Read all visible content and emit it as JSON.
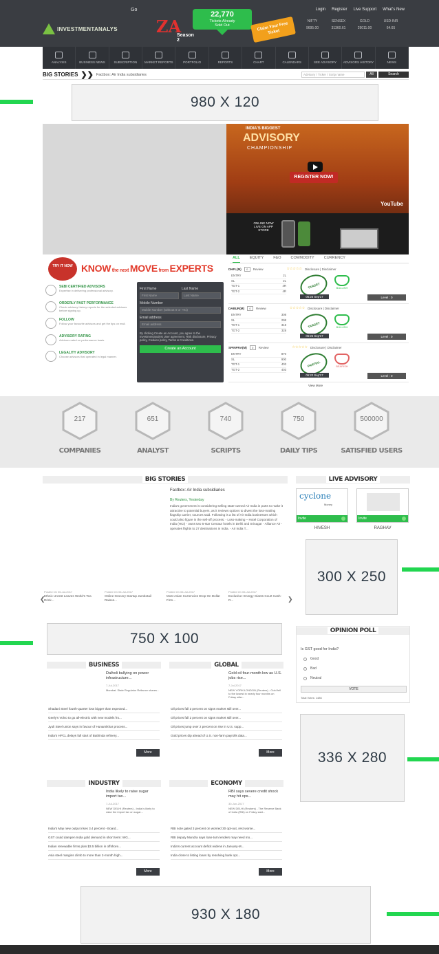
{
  "header": {
    "go_label": "Go",
    "links": [
      "Login",
      "Register",
      "Live Support",
      "What's New"
    ],
    "logo_text": "INVESTMENTANALYS",
    "ticket": {
      "count": "22,770",
      "sub1": "Tickets Already",
      "sub2": "Sold Out"
    },
    "champ_logo": {
      "mark": "ZA",
      "edition": "Season 2"
    },
    "ticket_badge": "Claim Your Free Ticket",
    "market": {
      "names": [
        "NIFTY",
        "SENSEX",
        "GOLD",
        "USD-INR"
      ],
      "values": [
        "9695.00",
        "31360.61",
        "29011.00",
        "64.65"
      ]
    }
  },
  "nav": {
    "items": [
      "Analysis",
      "Business News",
      "Subscription",
      "Market Reports",
      "Portfolio",
      "Reports",
      "Chart",
      "Calendars",
      "SEE Advisory",
      "Advisors History",
      "News"
    ]
  },
  "ticker": {
    "label": "BIG STORIES",
    "arrows": "❯❯",
    "headline": "Factbox: Air India subsidiaries",
    "search_placeholder": "Advisory / Ticker / Scrip name",
    "select_value": "All",
    "search_button": "Search"
  },
  "ads": {
    "top": "980 X 120",
    "mid": "300 X 250",
    "wide": "750 X 100",
    "side": "336 X 280",
    "bottom": "930 X 180"
  },
  "promo": {
    "title1": "INDIA'S BIGGEST",
    "title2": "ADVISORY",
    "title3": "CHAMPIONSHIP",
    "register": "REGISTER NOW!",
    "youtube": "YouTube",
    "live": "ONLINE NOW LIVE ON APP STORE"
  },
  "know": {
    "badge": "TRY IT NOW",
    "w1": "KNOW",
    "s1": " the next ",
    "w2": "MOVE",
    "s2": " from ",
    "w3": "EXPERTS",
    "features": [
      {
        "title": "SEBI CERTIFIED ADVISORS",
        "desc": "Expertise in delivering professional advisory."
      },
      {
        "title": "ORDERLY PAST PERFORMANCE",
        "desc": "Check advisory history reports for the selected advisors before signing up."
      },
      {
        "title": "FOLLOW",
        "desc": "Follow your favourite advisors and get the tips on mail."
      },
      {
        "title": "ADVISORY RATING",
        "desc": "Advisors rated on performance basis."
      },
      {
        "title": "LEGALITY ADVISORY",
        "desc": "Choose advisors that operated in legal manner."
      }
    ]
  },
  "form": {
    "first_name": "First Name",
    "last_name": "Last Name",
    "mobile": "Mobile Number",
    "mobile_placeholder": "Mobile Number (without 0 or +91)",
    "email": "Email address",
    "email_placeholder": "Email address",
    "terms": "By clicking Create an Account, you agree to the Investmentanalyst User agreement, Risk disclosure, Privacy policy, Cookies policy, Terms & Conditions.",
    "button": "Create an Account"
  },
  "tabs": [
    "ALL",
    "EQUITY",
    "F&O",
    "COMMODITY",
    "CURRENCY"
  ],
  "tips": [
    {
      "name": "DHFL(M)",
      "date": "06:25 Sep'17",
      "status": "TARGET",
      "type": "BULLISH",
      "level": "Level : 0",
      "rows": [
        [
          "ENTRY",
          "2L"
        ],
        [
          "SL",
          "2L"
        ],
        [
          "TGT-1",
          "4R"
        ],
        [
          "TGT-2",
          "4R"
        ]
      ],
      "review": "Review",
      "disc": "Disclosure | Disclaimer"
    },
    {
      "name": "DABUR(M)",
      "date": "06:25 Sep'17",
      "status": "TARGET",
      "type": "BULLISH",
      "level": "Level : 0",
      "rows": [
        [
          "ENTRY",
          "308"
        ],
        [
          "SL",
          "298"
        ],
        [
          "TGT-1",
          "318"
        ],
        [
          "TGT-2",
          "328"
        ]
      ],
      "review": "Review",
      "disc": "Disclosure | Disclaimer"
    },
    {
      "name": "SPINPRA(M)",
      "date": "06:22 Sep'17",
      "status": "PARTIAL",
      "type": "BEARISH",
      "level": "Level : 0",
      "rows": [
        [
          "ENTRY",
          "870"
        ],
        [
          "SL",
          "900"
        ],
        [
          "TGT-1",
          "403"
        ],
        [
          "TGT-2",
          "403"
        ]
      ],
      "review": "Review",
      "disc": "Disclosure | Disclaimer"
    }
  ],
  "view_more": "View More",
  "stats": [
    {
      "value": "217",
      "label": "COMPANIES"
    },
    {
      "value": "651",
      "label": "ANALYST"
    },
    {
      "value": "740",
      "label": "SCRIPTS"
    },
    {
      "value": "750",
      "label": "DAILY TIPS"
    },
    {
      "value": "500000",
      "label": "SATISFIED USERS"
    }
  ],
  "big_stories": {
    "heading": "BIG STORIES",
    "title": "Factbox: Air India subsidiaries",
    "byline": "By Reuters, Yesterday",
    "body": "India's government is considering selling state-owned Air India in parts to make it attractive to potential buyers, as it reviews options to divest the loss-making flagship carrier, sources said. Following is a list of Air India businesses which could also figure in the sell-off process: - Loss-making – Hotel Corporation of India (HCI) - owns two 5-star Centaur hotels in Delhi and Srinagar - Alliance Air - operates flights to 27 destinations in India. - Air India T...",
    "carousel": [
      {
        "date": "Posted On 06-Jul-2017",
        "title": "Ethnic Unrest Leaves World's Tea Drink..."
      },
      {
        "date": "Posted On 06-Jul-2017",
        "title": "Online Grocery Startup Jumbotail Raises..."
      },
      {
        "date": "Posted On 06-Jul-2017",
        "title": "Most Asian Currencies Drop On Dollar Firm..."
      },
      {
        "date": "Posted On 06-Jul-2017",
        "title": "Exclusive: Energy Giants Court Cash-R..."
      }
    ]
  },
  "live_advisory": {
    "heading": "LIVE ADVISORY",
    "advisors": [
      {
        "name": "Invite",
        "label": "HIVESH",
        "logo": "cyclone",
        "logo_sub": "Money"
      },
      {
        "name": "Invite",
        "label": "RAGHAV"
      }
    ]
  },
  "poll": {
    "heading": "OPINION POLL",
    "question": "Is GST good for India?",
    "options": [
      "Good",
      "Bad",
      "Neutral"
    ],
    "vote": "VOTE",
    "total": "Total Votes: 1486"
  },
  "news": {
    "business": {
      "heading": "BUSINESS",
      "feat_title": "Dalholi bullying on power infrastructure...",
      "feat_date": "7-Jul-2017",
      "feat_desc": "Mumbai: State Regulator Reliance shares...",
      "items": [
        "Shadani Steel fourth-quarter loss bigger than expected...",
        "Geely's Volvo to go all-electric with new models fro...",
        "Jyuli Steel union says in favour of Hunamikhar process...",
        "India's HPCL delays full start of Bathinda refinery..."
      ],
      "more": "More"
    },
    "global": {
      "heading": "GLOBAL",
      "feat_title": "Gold oil four-month low as U.S. jobs rise...",
      "feat_date": "7-Jul-2017",
      "feat_desc": "NEW YORK/LONDON (Reuters) - Gold fell to the lowest in nearly four months on Friday after...",
      "items": [
        "Oil prices fall 3 percent on signs market still over...",
        "Oil prices fall 2 percent on signs market still over...",
        "Oil prices jump over 2 percent on rise in U.S. supp...",
        "Gold prices dip ahead of U.S. non-farm payrolls data..."
      ],
      "more": "More"
    },
    "industry": {
      "heading": "INDUSTRY",
      "feat_title": "India likely to raise sugar import tax...",
      "feat_date": "7-Jul-2017",
      "feat_desc": "NEW DELHI (Reuters) - India is likely to raise the import tax on sugar...",
      "items": [
        "India's May new output rises 3.4 percent - Board...",
        "GST could dampen India gold demand in short term: WG...",
        "Indian renewable firms plan $3.5 billion in offshore...",
        "Asia steel margins climb to more than 2-month high..."
      ],
      "more": "More"
    },
    "economy": {
      "heading": "ECONOMY",
      "feat_title": "RBI says severe credit shock may hit ops...",
      "feat_date": "30-Jun-2017",
      "feat_desc": "NEW DELHI (Reuters) - The Reserve Bank of India (RBI) on Friday said...",
      "items": [
        "RBI note gated 3 percent on worried 30 opt-out, rest worse...",
        "RBI deputy Mundra says loan-turn lenders may need mo...",
        "India's current account deficit widens in January-M...",
        "India close to listing loans by resolving bank opt..."
      ],
      "more": "More"
    }
  }
}
